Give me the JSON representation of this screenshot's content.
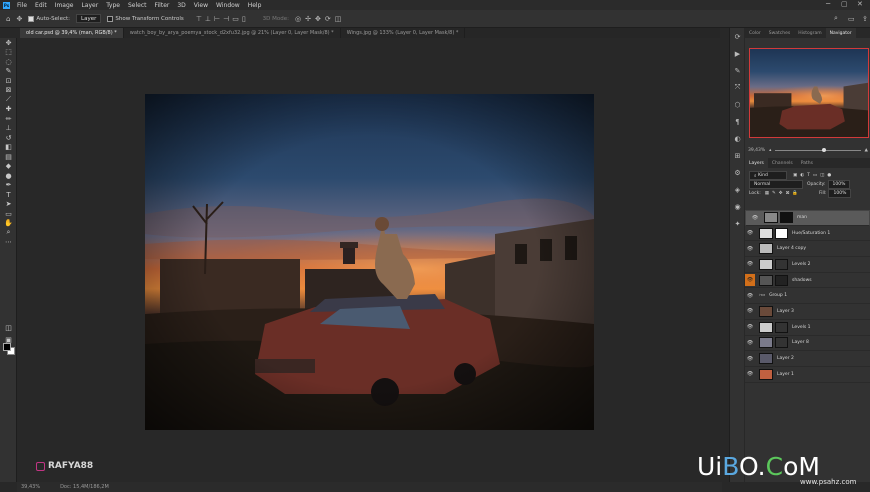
{
  "menu": {
    "logo": "Ps",
    "items": [
      "File",
      "Edit",
      "Image",
      "Layer",
      "Type",
      "Select",
      "Filter",
      "3D",
      "View",
      "Window",
      "Help"
    ],
    "window_controls": [
      "─",
      "▢",
      "✕"
    ]
  },
  "options": {
    "auto_select_label": "Auto-Select:",
    "auto_select_value": "Layer",
    "show_transform_label": "Show Transform Controls",
    "mode_3d": "3D Mode:"
  },
  "tabs": [
    {
      "label": "old car.psd @ 39,4% (man, RGB/8) *",
      "active": true
    },
    {
      "label": "watch_boy_by_arya_poemya_stock_d2xfu32.jpg @ 21% (Layer 0, Layer Mask/8) *",
      "active": false
    },
    {
      "label": "Wings.jpg @ 133% (Layer 0, Layer Mask/8) *",
      "active": false
    }
  ],
  "status": {
    "zoom": "39,43%",
    "doc": "Doc: 15,4M/186,2M"
  },
  "watermark": "RAFYA88",
  "panels": {
    "top_tabs": [
      "Color",
      "Swatches",
      "Histogram",
      "Navigator"
    ],
    "active_top": "Navigator",
    "zoom_value": "39,43%",
    "layer_tabs": [
      "Layers",
      "Channels",
      "Paths"
    ],
    "filter_label": "Kind",
    "blend_mode": "Normal",
    "opacity_label": "Opacity:",
    "opacity_value": "100%",
    "lock_label": "Lock:",
    "fill_label": "Fill:",
    "fill_value": "100%"
  },
  "layers": [
    {
      "name": "man",
      "selected": true,
      "eye_color": "normal",
      "thumb": "#888",
      "mask": "#111"
    },
    {
      "name": "Hue/Saturation 1",
      "selected": false,
      "eye_color": "normal",
      "thumb": "#ddd",
      "mask": "#fff"
    },
    {
      "name": "Layer 4 copy",
      "selected": false,
      "eye_color": "normal",
      "thumb": "#bbb",
      "mask": ""
    },
    {
      "name": "Levels 2",
      "selected": false,
      "eye_color": "normal",
      "thumb": "#ccc",
      "mask": "#333"
    },
    {
      "name": "shadows",
      "selected": false,
      "eye_color": "orange",
      "thumb": "#555",
      "mask": "#222"
    },
    {
      "name": "Group 1",
      "selected": false,
      "eye_color": "normal",
      "thumb": "",
      "mask": ""
    },
    {
      "name": "Layer 3",
      "selected": false,
      "eye_color": "normal",
      "thumb": "#6a4a3a",
      "mask": ""
    },
    {
      "name": "Levels 1",
      "selected": false,
      "eye_color": "normal",
      "thumb": "#ccc",
      "mask": "#333"
    },
    {
      "name": "Layer 8",
      "selected": false,
      "eye_color": "normal",
      "thumb": "#7a7a8a",
      "mask": "#333"
    },
    {
      "name": "Layer 2",
      "selected": false,
      "eye_color": "normal",
      "thumb": "#5a5a6a",
      "mask": ""
    },
    {
      "name": "Layer 1",
      "selected": false,
      "eye_color": "normal",
      "thumb": "#c06040",
      "mask": ""
    }
  ],
  "uibo": {
    "u": "Ui",
    "b": "B",
    "o": "O",
    "dot": ".",
    "c": "C",
    "rest": "oM",
    "sub": "www.psahz.com"
  }
}
